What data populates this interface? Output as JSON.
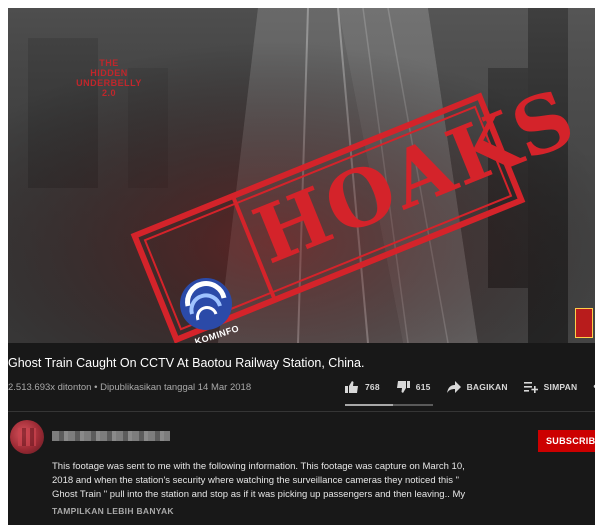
{
  "video": {
    "watermark_lines": [
      "THE",
      "HIDDEN",
      "UNDERBELLY",
      "2.0"
    ],
    "stamp_text": "HOAKS",
    "logo_text": "KOMINFO",
    "title": "Ghost Train Caught On CCTV At Baotou Railway Station, China.",
    "views": "2.513.693x ditonton",
    "separator": "•",
    "published": "Dipublikasikan tanggal 14 Mar 2018"
  },
  "actions": {
    "likes": "768",
    "dislikes": "615",
    "share_label": "BAGIKAN",
    "save_label": "SIMPAN",
    "more": "•••",
    "like_ratio": 0.55
  },
  "channel": {
    "subscribe_label": "SUBSCRIBE"
  },
  "description": {
    "lines": [
      "This footage was sent to me with the following information. This footage was capture on March 10,",
      "2018 and when the station's security where watching the surveillance cameras they noticed this \"",
      "Ghost Train \" pull into the station and stop as if it was picking up passengers and then leaving.. My"
    ],
    "show_more": "TAMPILKAN LEBIH BANYAK"
  },
  "colors": {
    "stamp_red": "#d4232a",
    "subscribe_red": "#cc0000",
    "background_dark": "#181818"
  }
}
